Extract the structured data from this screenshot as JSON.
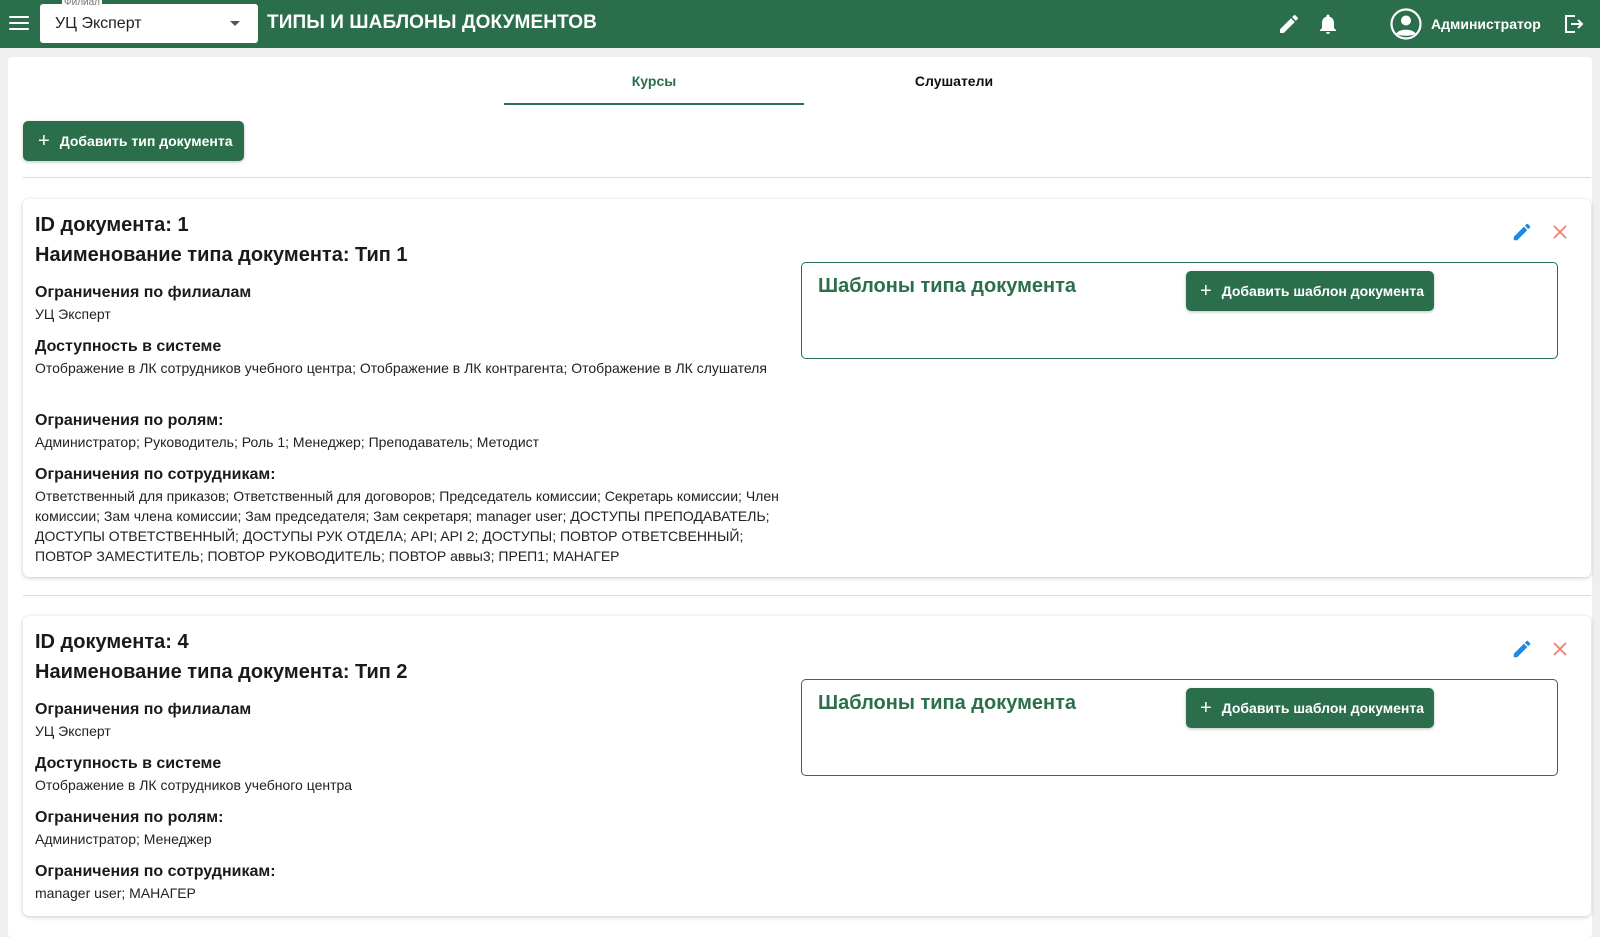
{
  "header": {
    "branch_label": "Филиал",
    "branch_value": "УЦ Эксперт",
    "title": "ТИПЫ И ШАБЛОНЫ ДОКУМЕНТОВ",
    "user_name": "Администратор"
  },
  "tabs": [
    {
      "label": "Курсы",
      "active": true
    },
    {
      "label": "Слушатели",
      "active": false
    }
  ],
  "add_type_button": "Добавить тип документа",
  "cards": [
    {
      "id_text": "ID документа: 1",
      "name_text": "Наименование типа документа: Тип 1",
      "fields": [
        {
          "title": "Ограничения по филиалам",
          "value": "УЦ Эксперт"
        },
        {
          "title": "Доступность в системе",
          "value": "Отображение в ЛК сотрудников учебного центра; Отображение в ЛК контрагента; Отображение в ЛК слушателя"
        },
        {
          "title": "Ограничения по ролям:",
          "value": "Администратор; Руководитель; Роль 1; Менеджер; Преподаватель; Методист"
        },
        {
          "title": "Ограничения по сотрудникам:",
          "value": "Ответственный для приказов; Ответственный для договоров; Председатель комиссии; Секретарь комиссии; Член комиссии; Зам члена комиссии; Зам председателя; Зам секретаря; manager user; ДОСТУПЫ ПРЕПОДАВАТЕЛЬ; ДОСТУПЫ ОТВЕТСТВЕННЫЙ; ДОСТУПЫ РУК ОТДЕЛА; API; API 2; ДОСТУПЫ; ПОВТОР ОТВЕТСВЕННЫЙ; ПОВТОР ЗАМЕСТИТЕЛЬ; ПОВТОР РУКОВОДИТЕЛЬ; ПОВТОР аввы3; ПРЕП1; МАНАГЕР"
        }
      ],
      "templates_title": "Шаблоны типа документа",
      "add_template_button": "Добавить шаблон документа"
    },
    {
      "id_text": "ID документа: 4",
      "name_text": "Наименование типа документа: Тип 2",
      "fields": [
        {
          "title": "Ограничения по филиалам",
          "value": "УЦ Эксперт"
        },
        {
          "title": "Доступность в системе",
          "value": "Отображение в ЛК сотрудников учебного центра"
        },
        {
          "title": "Ограничения по ролям:",
          "value": "Администратор; Менеджер"
        },
        {
          "title": "Ограничения по сотрудникам:",
          "value": "manager user; МАНАГЕР"
        }
      ],
      "templates_title": "Шаблоны типа документа",
      "add_template_button": "Добавить шаблон документа"
    }
  ],
  "colors": {
    "primary": "#2b6e4c",
    "edit_icon": "#1e88e5",
    "delete_icon": "#f08070"
  }
}
